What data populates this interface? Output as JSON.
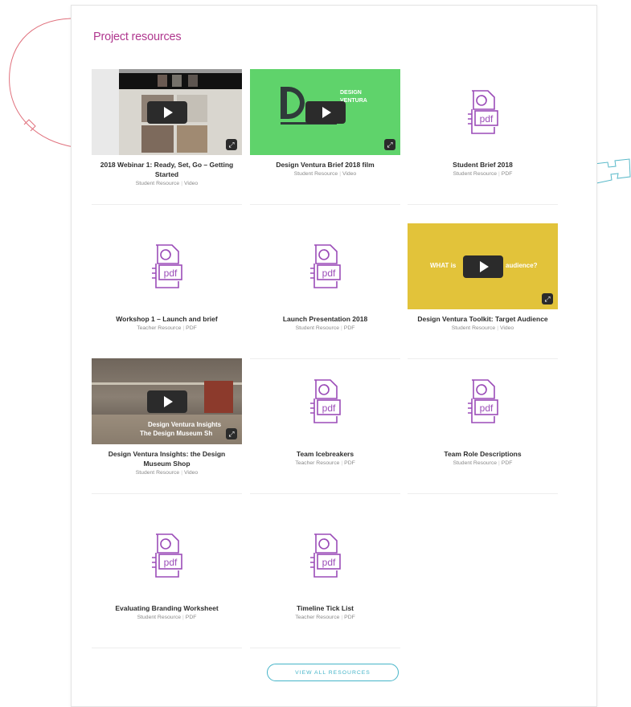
{
  "section": {
    "title": "Project resources"
  },
  "colors": {
    "accent": "#b0388f",
    "pdf_icon": "#9b4cb8",
    "button": "#45b4c8"
  },
  "cards": [
    {
      "title": "2018 Webinar 1: Ready, Set, Go – Getting Started",
      "category": "Student Resource",
      "type": "Video",
      "thumb": "webinar-video"
    },
    {
      "title": "Design Ventura Brief 2018 film",
      "category": "Student Resource",
      "type": "Video",
      "thumb": "green-video",
      "overlay": [
        "DESIGN",
        "VENTURA"
      ]
    },
    {
      "title": "Student Brief 2018",
      "category": "Student Resource",
      "type": "PDF",
      "thumb": "pdf-icon"
    },
    {
      "title": "Workshop 1 – Launch and brief",
      "category": "Teacher Resource",
      "type": "PDF",
      "thumb": "pdf-icon"
    },
    {
      "title": "Launch Presentation 2018",
      "category": "Student Resource",
      "type": "PDF",
      "thumb": "pdf-icon"
    },
    {
      "title": "Design Ventura Toolkit: Target Audience",
      "category": "Student Resource",
      "type": "Video",
      "thumb": "yellow-video",
      "overlay": [
        "WHAT is",
        "audience?"
      ]
    },
    {
      "title": "Design Ventura Insights: the Design Museum Shop",
      "category": "Student Resource",
      "type": "Video",
      "thumb": "shop-video",
      "overlay": [
        "Design Ventura Insights",
        "The Design Museum Sh"
      ]
    },
    {
      "title": "Team Icebreakers",
      "category": "Teacher Resource",
      "type": "PDF",
      "thumb": "pdf-icon"
    },
    {
      "title": "Team Role Descriptions",
      "category": "Student Resource",
      "type": "PDF",
      "thumb": "pdf-icon"
    },
    {
      "title": "Evaluating Branding Worksheet",
      "category": "Student Resource",
      "type": "PDF",
      "thumb": "pdf-icon"
    },
    {
      "title": "Timeline Tick List",
      "category": "Teacher Resource",
      "type": "PDF",
      "thumb": "pdf-icon"
    }
  ],
  "pdf_label": "pdf",
  "view_all_label": "VIEW ALL RESOURCES"
}
